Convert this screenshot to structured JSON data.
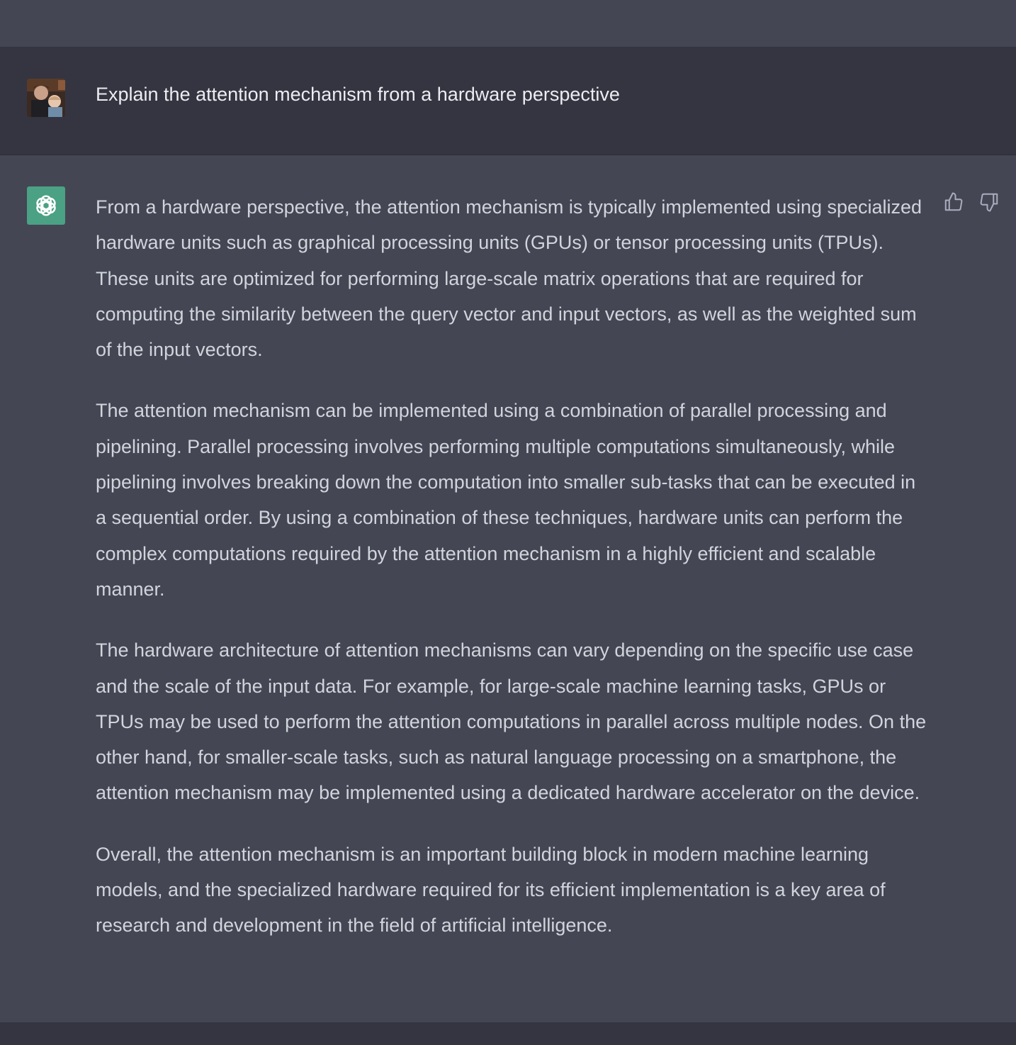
{
  "conversation": {
    "user_message": "Explain the attention mechanism from a hardware perspective",
    "assistant_paragraphs": [
      "From a hardware perspective, the attention mechanism is typically implemented using specialized hardware units such as graphical processing units (GPUs) or tensor processing units (TPUs). These units are optimized for performing large-scale matrix operations that are required for computing the similarity between the query vector and input vectors, as well as the weighted sum of the input vectors.",
      "The attention mechanism can be implemented using a combination of parallel processing and pipelining. Parallel processing involves performing multiple computations simultaneously, while pipelining involves breaking down the computation into smaller sub-tasks that can be executed in a sequential order. By using a combination of these techniques, hardware units can perform the complex computations required by the attention mechanism in a highly efficient and scalable manner.",
      "The hardware architecture of attention mechanisms can vary depending on the specific use case and the scale of the input data. For example, for large-scale machine learning tasks, GPUs or TPUs may be used to perform the attention computations in parallel across multiple nodes. On the other hand, for smaller-scale tasks, such as natural language processing on a smartphone, the attention mechanism may be implemented using a dedicated hardware accelerator on the device.",
      "Overall, the attention mechanism is an important building block in modern machine learning models, and the specialized hardware required for its efficient implementation is a key area of research and development in the field of artificial intelligence."
    ]
  },
  "icons": {
    "user_avatar": "user-photo-avatar",
    "assistant_avatar": "openai-logo-icon",
    "feedback_up": "thumbs-up-icon",
    "feedback_down": "thumbs-down-icon"
  },
  "colors": {
    "page_background": "#444654",
    "user_row_background": "#343541",
    "assistant_avatar_background": "#4aa183",
    "user_text": "#ececf1",
    "assistant_text": "#d1d5db",
    "icon_color": "#acacbe"
  }
}
